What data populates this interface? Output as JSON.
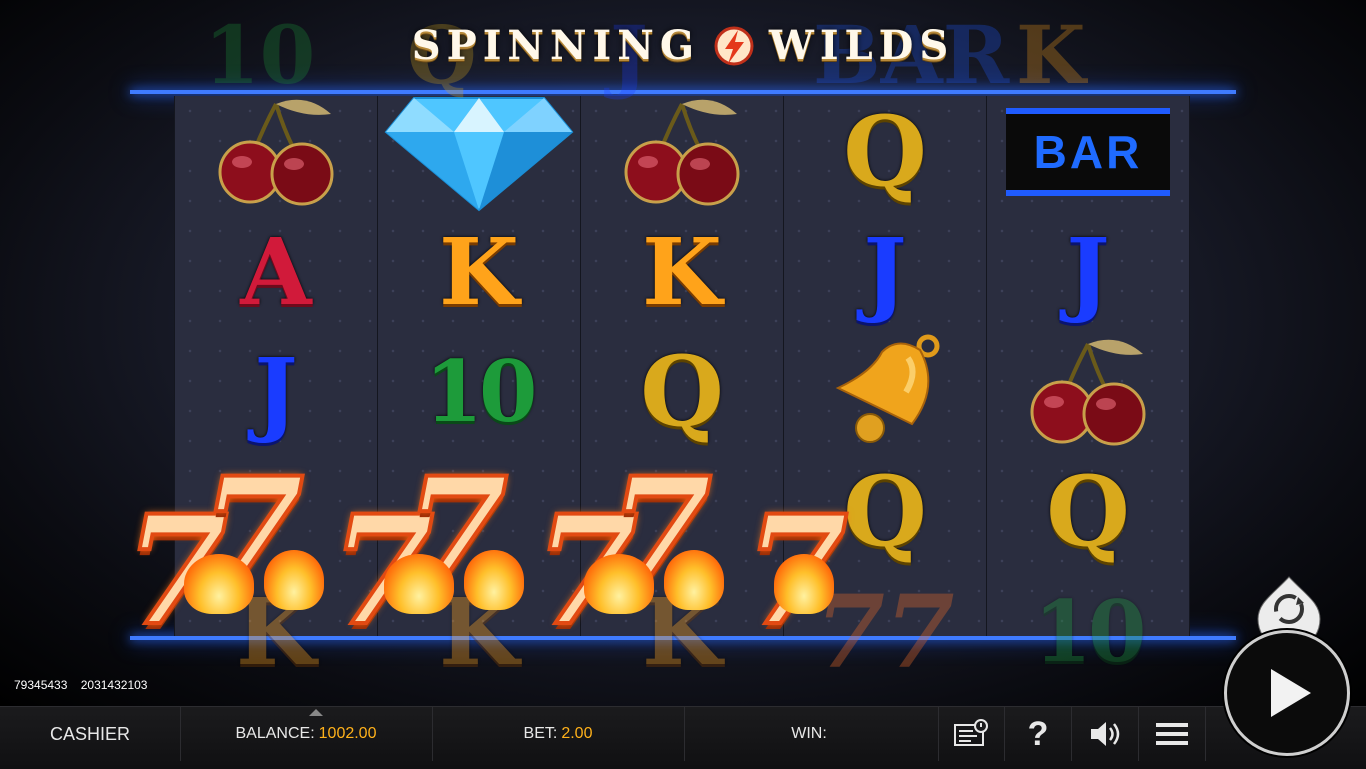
{
  "game": {
    "title_left": "SPINNING",
    "title_right": "WILDS"
  },
  "reels": [
    {
      "symbols": [
        "cherry",
        "A",
        "J",
        "7",
        "K"
      ],
      "ghost_top": "10"
    },
    {
      "symbols": [
        "diamond",
        "K",
        "10",
        "7",
        "K"
      ],
      "ghost_top": "Q"
    },
    {
      "symbols": [
        "cherry",
        "K",
        "Q",
        "7",
        "K"
      ],
      "ghost_top": "J"
    },
    {
      "symbols": [
        "Q",
        "J",
        "bell",
        "Q",
        "7"
      ],
      "ghost_top": "BAR"
    },
    {
      "symbols": [
        "BAR",
        "J",
        "cherry",
        "Q",
        "10"
      ],
      "ghost_top": "K"
    }
  ],
  "symbol_text": {
    "A": "A",
    "K": "K",
    "Q": "Q",
    "J": "J",
    "10": "10",
    "BAR": "BAR",
    "seven": "7"
  },
  "session": {
    "id_1": "79345433",
    "id_2": "2031432103"
  },
  "bottom_bar": {
    "cashier_label": "CASHIER",
    "balance_label": "BALANCE:",
    "balance_value": "1002.00",
    "bet_label": "BET:",
    "bet_value": "2.00",
    "win_label": "WIN:",
    "win_value": "",
    "help_label": "?"
  },
  "icons": {
    "logo": "lightning-bolt-icon",
    "paytable": "paytable-icon",
    "help": "help-icon",
    "sound": "speaker-icon",
    "menu": "hamburger-menu-icon",
    "autoplay": "autoplay-icon",
    "spin": "play-icon"
  },
  "colors": {
    "accent_neon": "#3f7bff",
    "value_orange": "#ffb11a"
  }
}
